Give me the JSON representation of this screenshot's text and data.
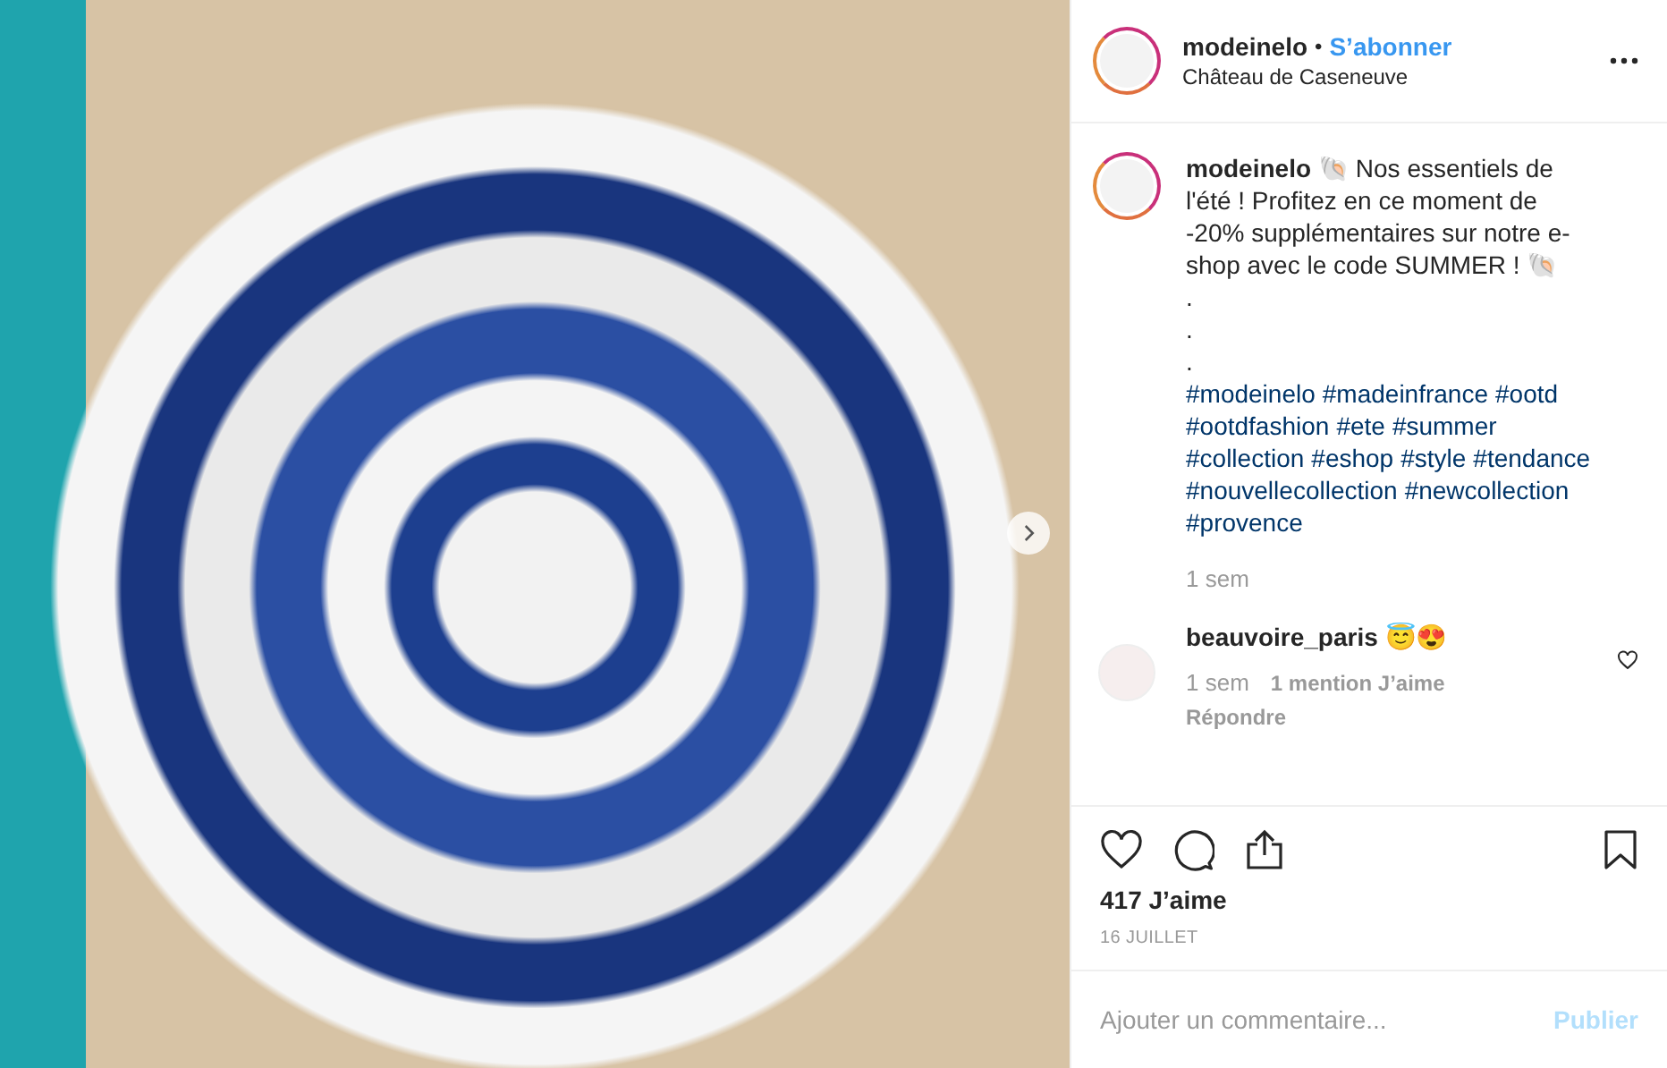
{
  "post": {
    "photo": {
      "has_next": true
    },
    "header": {
      "username": "modeinelo",
      "separator": "•",
      "follow": "S’abonner",
      "location": "Château de Caseneuve"
    },
    "caption": {
      "username": "modeinelo",
      "text": "🐚 Nos essentiels de l'été ! Profitez en ce moment de -20% supplémentaires sur notre e-shop avec le code SUMMER ! 🐚",
      "dots": [
        ".",
        ".",
        "."
      ],
      "hashtags": [
        "#modeinelo",
        "#madeinfrance",
        "#ootd",
        "#ootdfashion",
        "#ete",
        "#summer",
        "#collection",
        "#eshop",
        "#style",
        "#tendance",
        "#nouvellecollection",
        "#newcollection",
        "#provence"
      ],
      "time": "1 sem"
    },
    "comments": [
      {
        "username": "beauvoire_paris",
        "text": "😇😍",
        "time": "1 sem",
        "likes": "1 mention J’aime",
        "reply": "Répondre",
        "liked": false
      }
    ],
    "likes": "417 J’aime",
    "date": "16 JUILLET",
    "comment_box": {
      "placeholder": "Ajouter un commentaire...",
      "submit": "Publier",
      "disabled": true
    }
  }
}
